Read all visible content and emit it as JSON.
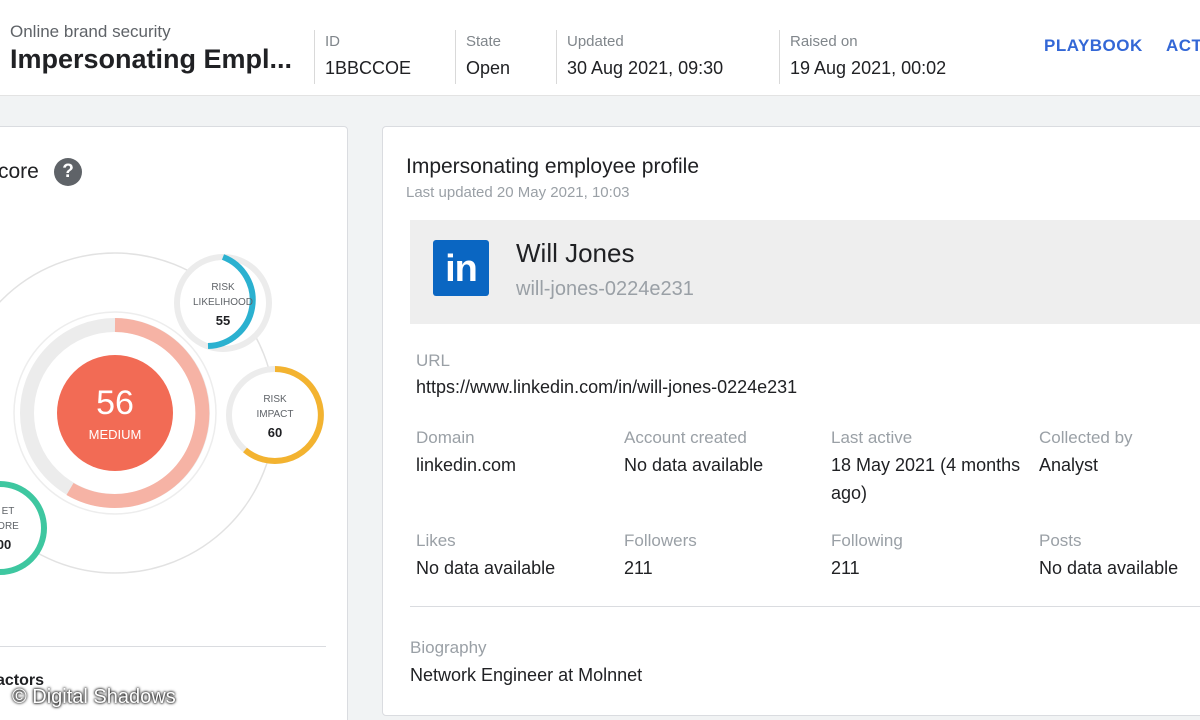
{
  "header": {
    "section": "Online brand security",
    "title": "Impersonating Empl...",
    "meta": [
      {
        "label": "ID",
        "value": "1BBCCOE"
      },
      {
        "label": "State",
        "value": "Open"
      },
      {
        "label": "Updated",
        "value": "30 Aug 2021, 09:30"
      },
      {
        "label": "Raised on",
        "value": "19 Aug 2021, 00:02"
      }
    ],
    "links": {
      "playbook": "PLAYBOOK",
      "actions": "ACT"
    }
  },
  "score_panel": {
    "title": "core",
    "help_icon": "question-mark-icon",
    "overall": {
      "value": "56",
      "level": "MEDIUM",
      "color": "#f26b55"
    },
    "likelihood": {
      "label1": "RISK",
      "label2": "LIKELIHOOD",
      "value": "55",
      "color": "#2bb1d0"
    },
    "impact": {
      "label1": "RISK",
      "label2": "IMPACT",
      "value": "60",
      "color": "#f3b330"
    },
    "asset": {
      "label1": "ET",
      "label2": "ORE",
      "value": "00",
      "color": "#3ec7a0"
    },
    "factors_title": "actors"
  },
  "profile": {
    "title": "Impersonating employee profile",
    "last_updated": "Last updated 20 May 2021, 10:03",
    "logo": "in",
    "logo_name": "linkedin-logo-icon",
    "name": "Will Jones",
    "handle": "will-jones-0224e231",
    "url_label": "URL",
    "url": "https://www.linkedin.com/in/will-jones-0224e231",
    "fields": {
      "domain": {
        "label": "Domain",
        "value": "linkedin.com"
      },
      "account_created": {
        "label": "Account created",
        "value": "No data available"
      },
      "last_active": {
        "label": "Last active",
        "value1": "18 May 2021 (4 months",
        "value2": "ago)"
      },
      "collected_by": {
        "label": "Collected by",
        "value": "Analyst"
      },
      "likes": {
        "label": "Likes",
        "value": "No data available"
      },
      "followers": {
        "label": "Followers",
        "value": "211"
      },
      "following": {
        "label": "Following",
        "value": "211"
      },
      "posts": {
        "label": "Posts",
        "value": "No data available"
      }
    },
    "biography_label": "Biography",
    "biography": "Network Engineer at Molnnet"
  },
  "watermark": "© Digital Shadows"
}
